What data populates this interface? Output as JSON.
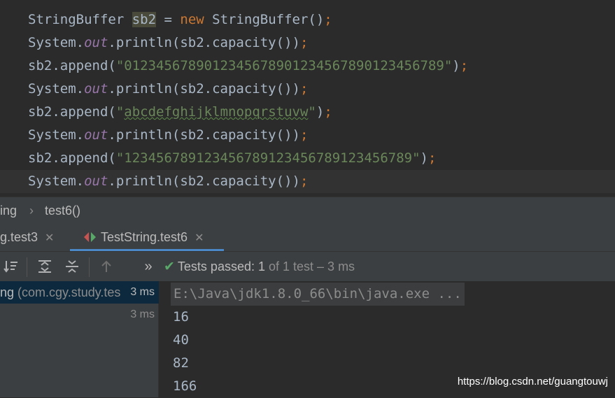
{
  "editor": {
    "lines": [
      {
        "a": "StringBuffer ",
        "var": "sb2",
        "b": " = ",
        "kw": "new",
        "c": " StringBuffer()",
        "semi": ";"
      },
      {
        "pre": "System.",
        "field": "out",
        "post": ".println(sb2.capacity())",
        "semi": ";"
      },
      {
        "pre": "sb2.append(",
        "str": "\"0123456789012345678901234567890123456789\"",
        "post": ")",
        "semi": ";"
      },
      {
        "pre": "System.",
        "field": "out",
        "post": ".println(sb2.capacity())",
        "semi": ";"
      },
      {
        "pre": "sb2.append(",
        "str_q1": "\"",
        "str_typo": "abcdefghijklmnopqrstuvw",
        "str_q2": "\"",
        "post": ")",
        "semi": ";"
      },
      {
        "pre": "System.",
        "field": "out",
        "post": ".println(sb2.capacity())",
        "semi": ";"
      },
      {
        "pre": "sb2.append(",
        "str": "\"123456789123456789123456789123456789\"",
        "post": ")",
        "semi": ";"
      },
      {
        "pre": "System.",
        "field": "out",
        "post": ".println(sb2.capacity())",
        "semi": ";"
      }
    ]
  },
  "breadcrumb": {
    "parent": "ing",
    "sep": "›",
    "method": "test6()"
  },
  "tabs": [
    {
      "label": "g.test3",
      "close": "✕"
    },
    {
      "label": "TestString.test6",
      "close": "✕"
    }
  ],
  "toolbar": {
    "more": "»",
    "check": "✔",
    "status_main": "Tests passed: ",
    "status_count": "1",
    "status_rest": " of 1 test – 3 ms"
  },
  "tree": {
    "root": {
      "name": "ng",
      "pkg": " (com.cgy.study.tes",
      "time": "3 ms"
    },
    "child": {
      "time": "3 ms"
    }
  },
  "console": {
    "cmd": "E:\\Java\\jdk1.8.0_66\\bin\\java.exe ...",
    "outputs": [
      "16",
      "40",
      "82",
      "166"
    ]
  },
  "watermark": "https://blog.csdn.net/guangtouwj",
  "colors": {
    "keyword": "#cc7832",
    "string": "#6a8759",
    "field": "#9876aa",
    "accent": "#4a88c7",
    "pass": "#59a869"
  }
}
